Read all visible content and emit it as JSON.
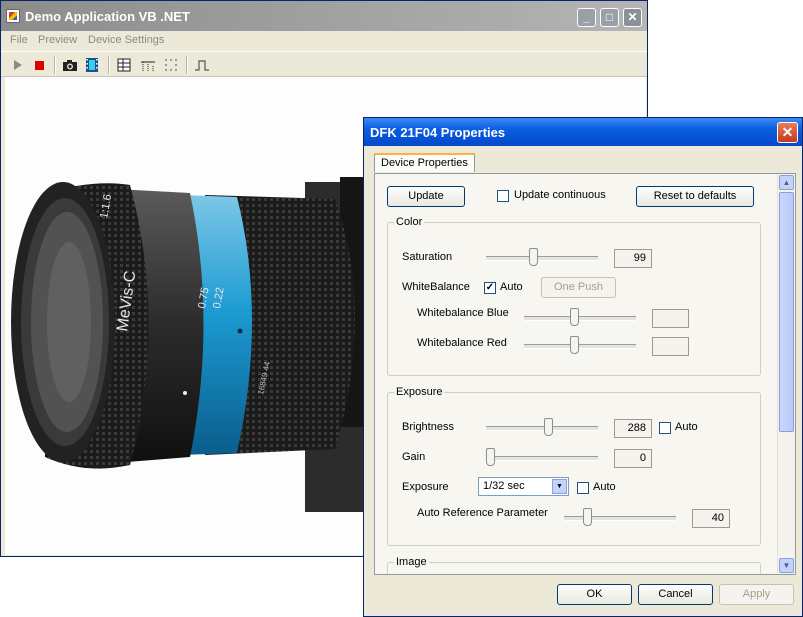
{
  "main_window": {
    "title": "Demo Application VB .NET",
    "menu": [
      "File",
      "Preview",
      "Device Settings"
    ],
    "toolbar": {
      "icons": [
        "play-icon",
        "stop-icon",
        "camera-icon",
        "film-icon",
        "properties-icon",
        "roi-icon",
        "grid-icon",
        "trigger-icon"
      ]
    },
    "image_text": {
      "brand": "MeVis-C",
      "focal": "1:1.6",
      "scale1": "0.75",
      "scale2": "0.22",
      "serial": "16849 44"
    }
  },
  "dialog": {
    "title": "DFK 21F04 Properties",
    "tab": "Device Properties",
    "buttons": {
      "update": "Update",
      "update_continuous": "Update continuous",
      "reset": "Reset to defaults",
      "ok": "OK",
      "cancel": "Cancel",
      "apply": "Apply",
      "one_push": "One Push"
    },
    "color_group": {
      "title": "Color",
      "saturation_label": "Saturation",
      "saturation_value": "99",
      "saturation_level": 0.42,
      "whitebalance_label": "WhiteBalance",
      "whitebalance_auto_label": "Auto",
      "whitebalance_auto": true,
      "wb_blue_label": "Whitebalance Blue",
      "wb_blue_level": 0.45,
      "wb_red_label": "Whitebalance Red",
      "wb_red_level": 0.45
    },
    "exposure_group": {
      "title": "Exposure",
      "brightness_label": "Brightness",
      "brightness_value": "288",
      "brightness_level": 0.56,
      "brightness_auto_label": "Auto",
      "gain_label": "Gain",
      "gain_value": "0",
      "gain_level": 0.0,
      "exposure_label": "Exposure",
      "exposure_value": "1/32 sec",
      "exposure_auto_label": "Auto",
      "arp_label": "Auto Reference Parameter",
      "arp_value": "40",
      "arp_level": 0.18
    },
    "image_group": {
      "title": "Image"
    }
  }
}
